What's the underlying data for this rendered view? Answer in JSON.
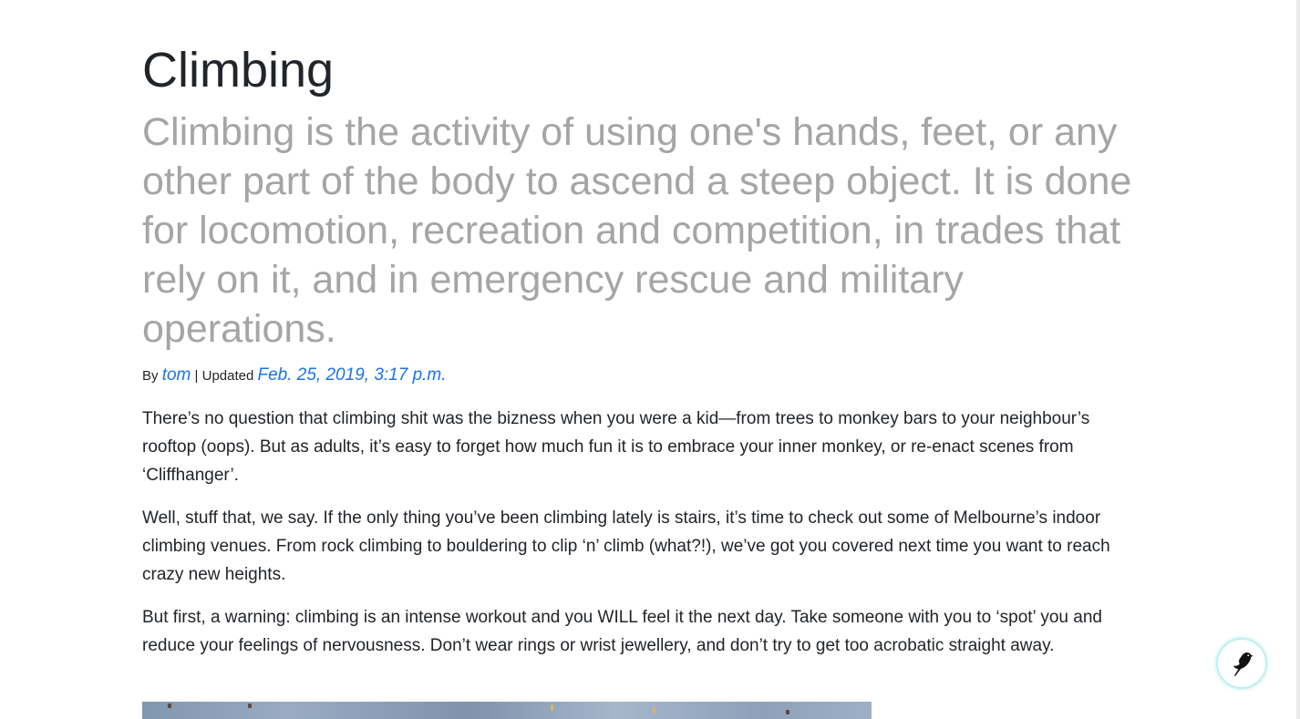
{
  "article": {
    "title": "Climbing",
    "lead": "Climbing is the activity of using one's hands, feet, or any other part of the body to ascend a steep object. It is done for locomotion, recreation and competition, in trades that rely on it, and in emergency rescue and military operations.",
    "byline": {
      "by_label": "By",
      "author": "tom",
      "separator": "| Updated",
      "updated": "Feb. 25, 2019, 3:17 p.m."
    },
    "paragraphs": [
      "There’s no question that climbing shit was the bizness when you were a kid—from trees to monkey bars to your neighbour’s rooftop (oops). But as adults, it’s easy to forget how much fun it is to embrace your inner monkey, or re-enact scenes from ‘Cliffhanger’.",
      "Well, stuff that, we say. If the only thing you’ve been climbing lately is stairs, it’s time to check out some of Melbourne’s indoor climbing venues. From rock climbing to bouldering to clip ‘n’ climb (what?!), we’ve got you covered next time you want to reach crazy new heights.",
      "But first, a warning: climbing is an intense workout and you WILL feel it the next day. Take someone with you to ‘spot’ you and reduce your feelings of nervousness. Don’t wear rings or wrist jewellery, and don’t try to get too acrobatic straight away."
    ]
  },
  "floating_button": {
    "icon": "bird-icon"
  },
  "colors": {
    "link": "#1a73e8",
    "lead_text": "#a5a5a5",
    "body_text": "#212529",
    "float_border": "#bff0f0"
  }
}
